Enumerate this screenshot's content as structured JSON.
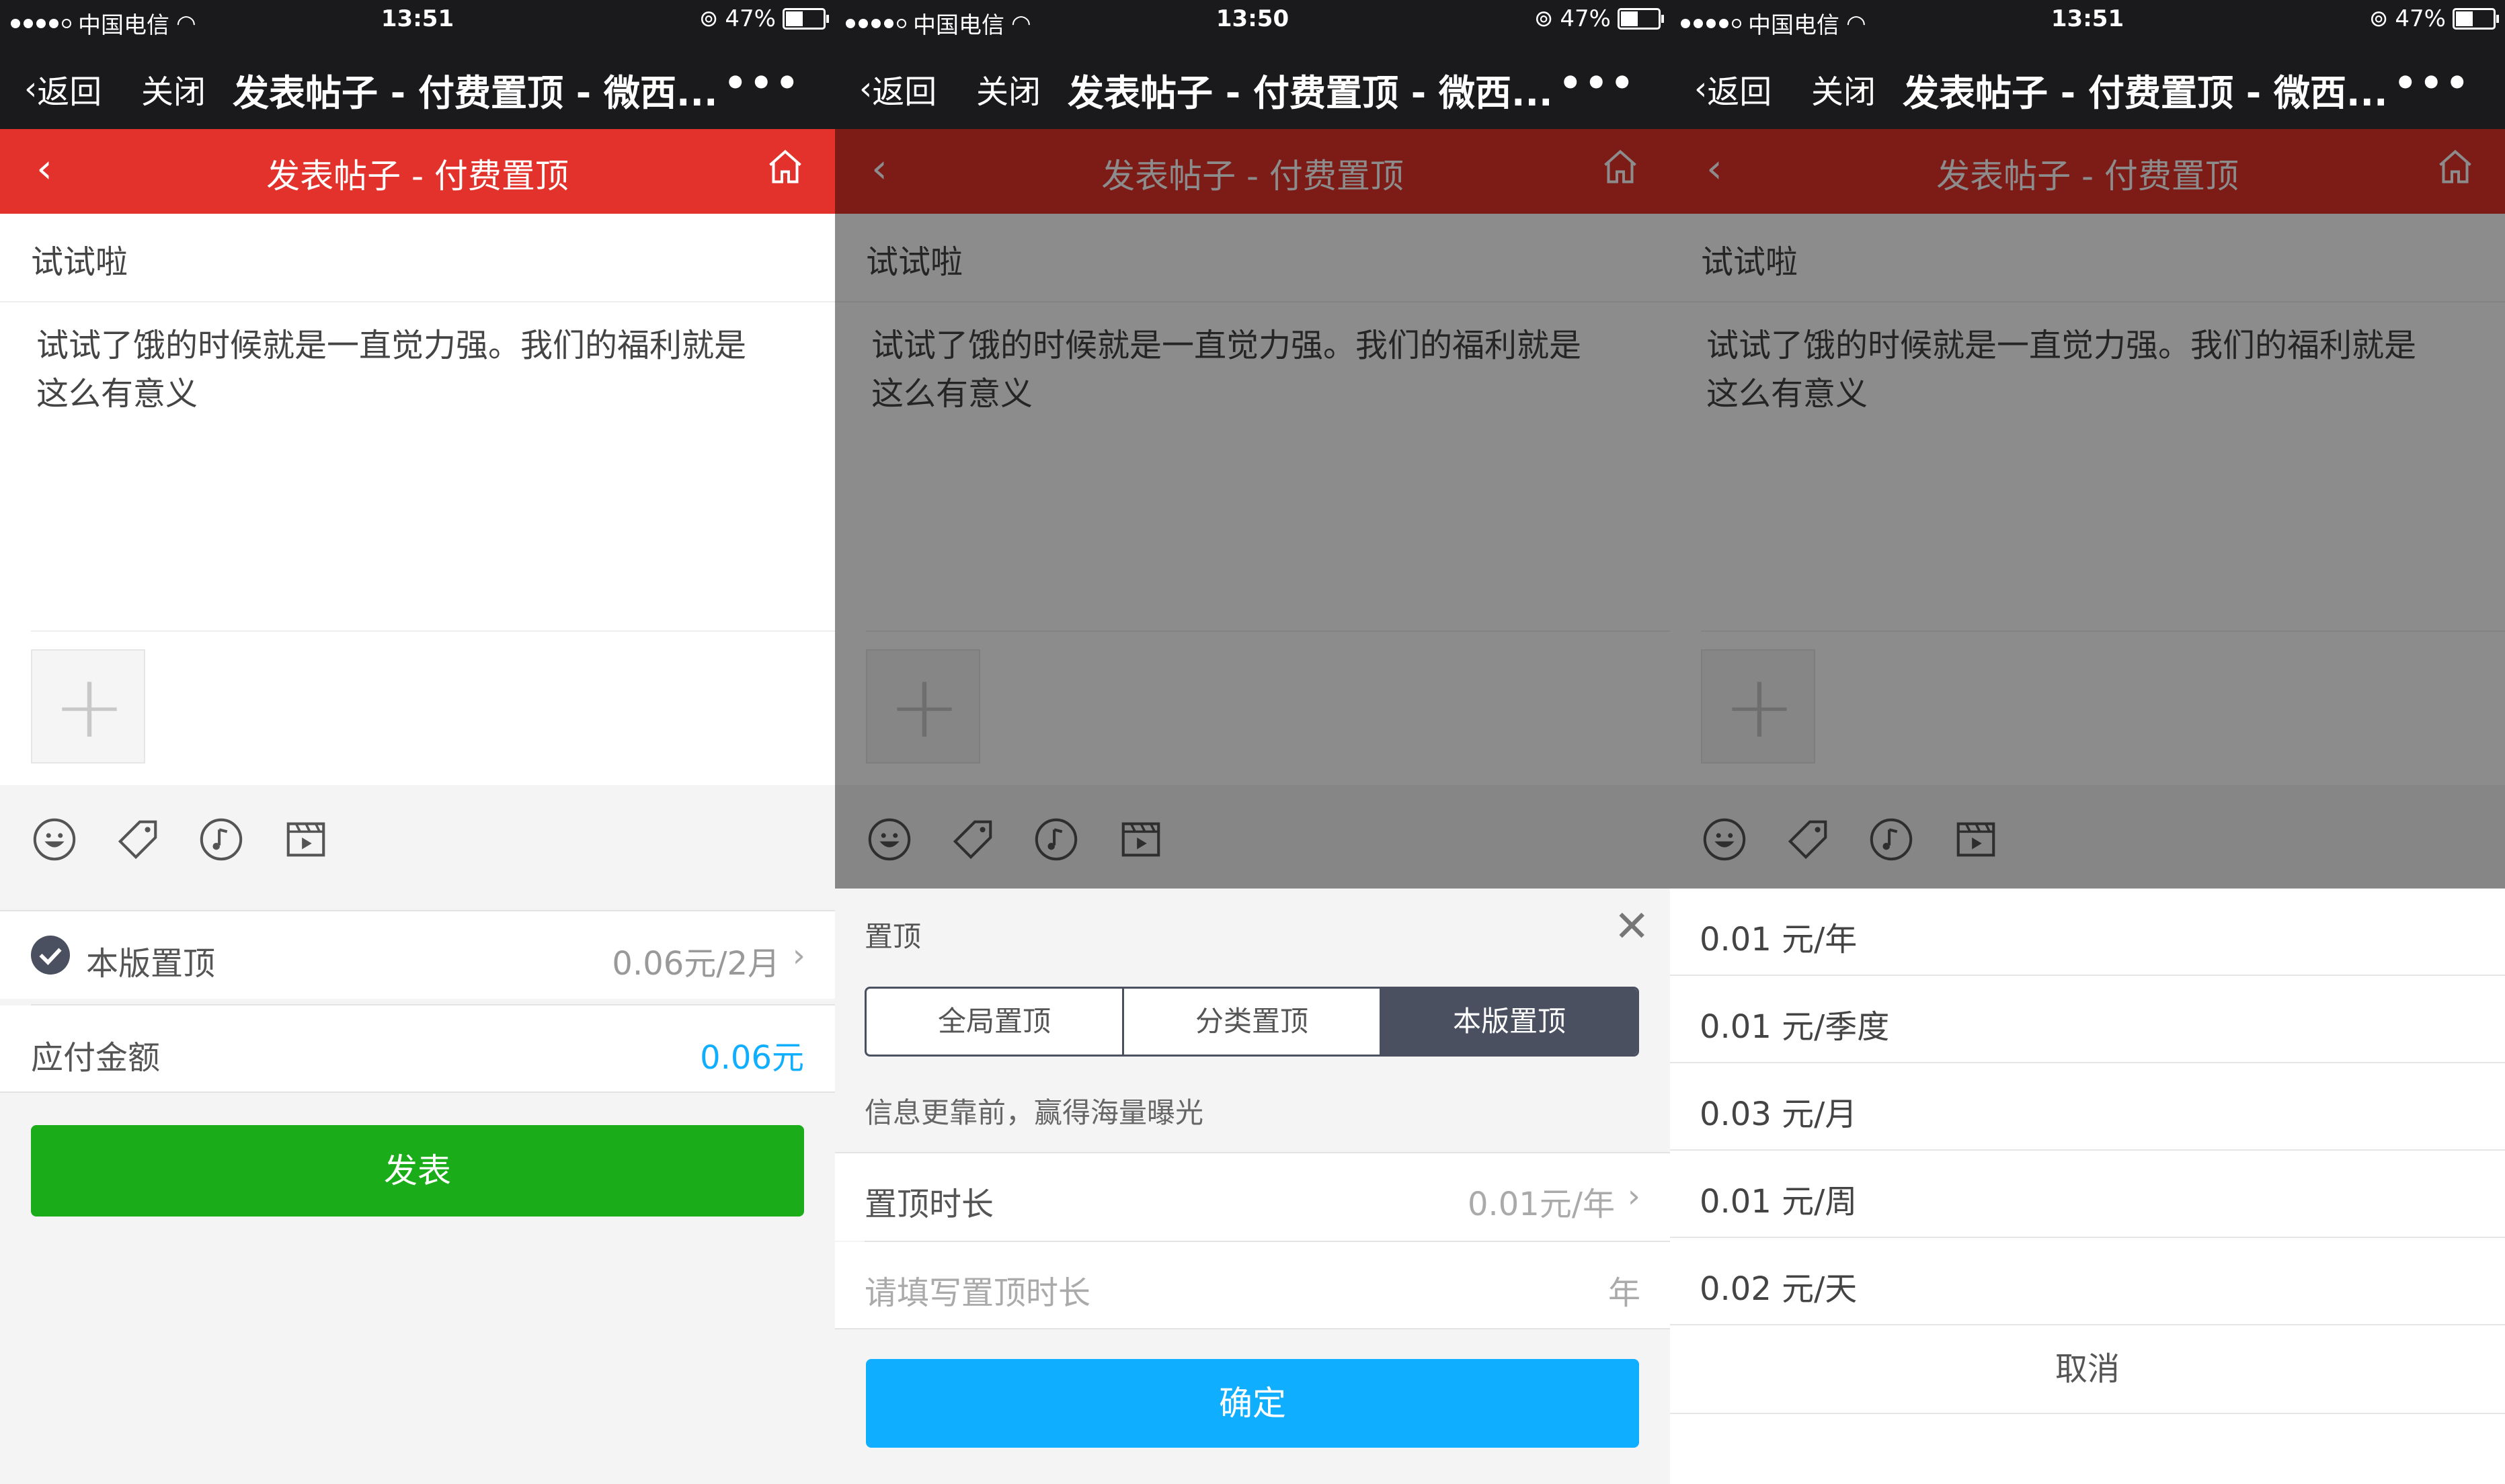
{
  "screens": [
    {
      "status": {
        "carrier": "中国电信",
        "time": "13:51",
        "battery": "47%"
      },
      "wx": {
        "back": "返回",
        "close": "关闭",
        "title": "发表帖子 - 付费置顶 - 微西...",
        "more": "•••"
      },
      "header": {
        "title": "发表帖子 - 付费置顶"
      },
      "post": {
        "subject": "试试啦",
        "body": "试试了饿的时候就是一直觉力强。我们的福利就是这么有意义"
      },
      "pin": {
        "label": "本版置顶",
        "price": "0.06元/2月"
      },
      "payment": {
        "label": "应付金额",
        "amount": "0.06元"
      },
      "submit": "发表"
    },
    {
      "status": {
        "carrier": "中国电信",
        "time": "13:50",
        "battery": "47%"
      },
      "wx": {
        "back": "返回",
        "close": "关闭",
        "title": "发表帖子 - 付费置顶 - 微西...",
        "more": "•••"
      },
      "header": {
        "title": "发表帖子 - 付费置顶"
      },
      "post": {
        "subject": "试试啦",
        "body": "试试了饿的时候就是一直觉力强。我们的福利就是这么有意义"
      },
      "sheet": {
        "title": "置顶",
        "tabs": [
          "全局置顶",
          "分类置顶",
          "本版置顶"
        ],
        "active_tab": 2,
        "hint": "信息更靠前，赢得海量曝光",
        "duration_label": "置顶时长",
        "duration_value": "0.01元/年",
        "input_placeholder": "请填写置顶时长",
        "input_unit": "年",
        "confirm": "确定"
      }
    },
    {
      "status": {
        "carrier": "中国电信",
        "time": "13:51",
        "battery": "47%"
      },
      "wx": {
        "back": "返回",
        "close": "关闭",
        "title": "发表帖子 - 付费置顶 - 微西...",
        "more": "•••"
      },
      "header": {
        "title": "发表帖子 - 付费置顶"
      },
      "post": {
        "subject": "试试啦",
        "body": "试试了饿的时候就是一直觉力强。我们的福利就是这么有意义"
      },
      "picker": {
        "options": [
          "0.01 元/年",
          "0.01 元/季度",
          "0.03 元/月",
          "0.01 元/周",
          "0.02 元/天"
        ],
        "cancel": "取消"
      }
    }
  ],
  "battery_level": 0.47,
  "colors": {
    "red_header": "#e3322b",
    "green_button": "#1aad19",
    "blue_button": "#10aeff",
    "amount_blue": "#10aeff",
    "segment_dark": "#4a5060"
  }
}
